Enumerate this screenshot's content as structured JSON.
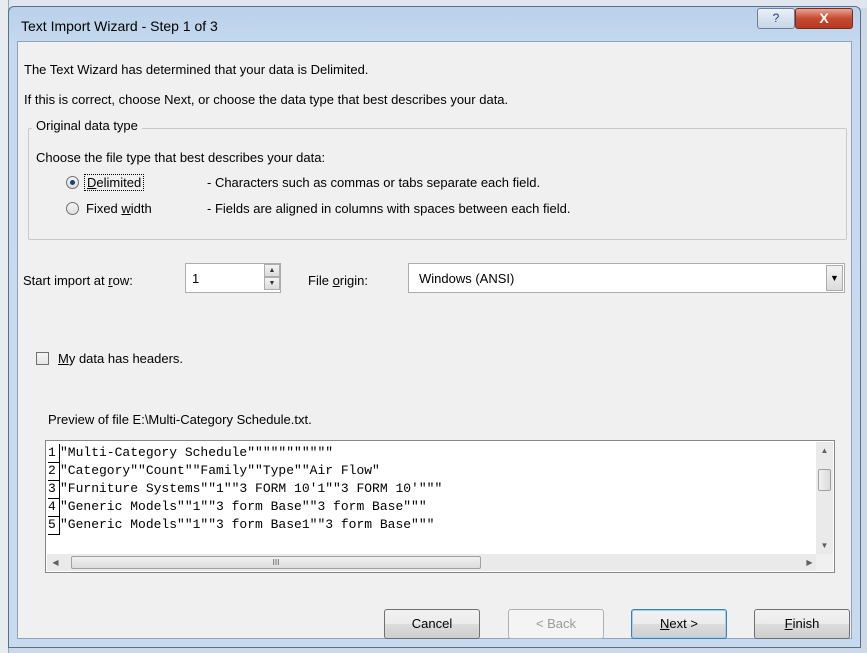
{
  "window": {
    "title": "Text Import Wizard - Step 1 of 3",
    "help_icon": "?",
    "close_icon": "X"
  },
  "intro": {
    "line1": "The Text Wizard has determined that your data is Delimited.",
    "line2": "If this is correct, choose Next, or choose the data type that best describes your data."
  },
  "original_data_type": {
    "legend": "Original data type",
    "prompt": "Choose the file type that best describes your data:",
    "options": [
      {
        "label_pre": "",
        "label_accel": "D",
        "label_post": "elimited",
        "description": "- Characters such as commas or tabs separate each field.",
        "selected": true
      },
      {
        "label_pre": "Fixed ",
        "label_accel": "w",
        "label_post": "idth",
        "description": "- Fields are aligned in columns with spaces between each field.",
        "selected": false
      }
    ]
  },
  "start_row": {
    "label_pre": "Start import at ",
    "label_accel": "r",
    "label_post": "ow:",
    "value": "1"
  },
  "file_origin": {
    "label_pre": "File ",
    "label_accel": "o",
    "label_post": "rigin:",
    "value": "Windows (ANSI)"
  },
  "headers_checkbox": {
    "label_accel": "M",
    "label_post": "y data has headers.",
    "checked": false
  },
  "preview": {
    "label": "Preview of file E:\\Multi-Category Schedule.txt.",
    "rows": [
      {
        "num": "1",
        "text": "\"Multi-Category Schedule\"\"\"\"\"\"\"\"\"\"\""
      },
      {
        "num": "2",
        "text": "\"Category\"\"Count\"\"Family\"\"Type\"\"Air Flow\""
      },
      {
        "num": "3",
        "text": "\"Furniture Systems\"\"1\"\"3 FORM 10'1\"\"3 FORM 10'\"\"\""
      },
      {
        "num": "4",
        "text": "\"Generic Models\"\"1\"\"3 form Base\"\"3 form Base\"\"\""
      },
      {
        "num": "5",
        "text": "\"Generic Models\"\"1\"\"3 form Base1\"\"3 form Base\"\"\""
      }
    ],
    "hscroll_grip": "III"
  },
  "buttons": {
    "cancel": "Cancel",
    "back": "< Back",
    "next_accel": "N",
    "next_post": "ext >",
    "finish_accel": "F",
    "finish_post": "inish"
  }
}
